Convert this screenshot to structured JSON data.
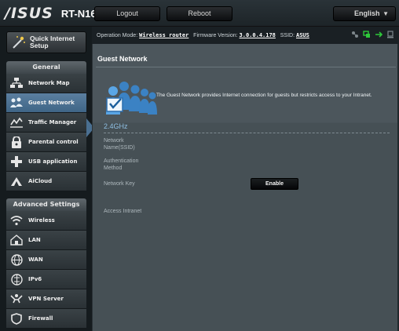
{
  "header": {
    "brand": "/ISUS",
    "model": "RT-N16",
    "logout_label": "Logout",
    "reboot_label": "Reboot",
    "language": "English"
  },
  "status": {
    "mode_label": "Operation Mode:",
    "mode_value": "Wireless router",
    "firmware_label": "Firmware Version:",
    "firmware_value": "3.0.0.4.178",
    "ssid_label": "SSID:",
    "ssid_value": "ASUS"
  },
  "sidebar": {
    "quick_setup": "Quick Internet\nSetup",
    "general_title": "General",
    "general_items": [
      {
        "label": "Network Map",
        "icon": "network-map-icon"
      },
      {
        "label": "Guest Network",
        "icon": "guest-network-icon",
        "active": true
      },
      {
        "label": "Traffic Manager",
        "icon": "traffic-manager-icon"
      },
      {
        "label": "Parental control",
        "icon": "parental-control-icon"
      },
      {
        "label": "USB application",
        "icon": "usb-application-icon"
      },
      {
        "label": "AiCloud",
        "icon": "aicloud-icon"
      }
    ],
    "advanced_title": "Advanced Settings",
    "advanced_items": [
      {
        "label": "Wireless",
        "icon": "wireless-icon"
      },
      {
        "label": "LAN",
        "icon": "lan-icon"
      },
      {
        "label": "WAN",
        "icon": "wan-icon"
      },
      {
        "label": "IPv6",
        "icon": "ipv6-icon"
      },
      {
        "label": "VPN Server",
        "icon": "vpn-server-icon"
      },
      {
        "label": "Firewall",
        "icon": "firewall-icon"
      }
    ]
  },
  "main": {
    "title": "Guest Network",
    "description": "The Guest Network provides Internet connection for guests but restricts access to your Intranet.",
    "band": "2.4GHz",
    "fields": {
      "ssid": "Network\nName(SSID)",
      "auth": "Authentication\nMethod",
      "key": "Network Key"
    },
    "enable_label": "Enable",
    "access_intranet": "Access Intranet"
  },
  "colors": {
    "active_menu": "#4f7598",
    "band_text": "#8fbfe3",
    "status_green": "#2ec83a"
  }
}
